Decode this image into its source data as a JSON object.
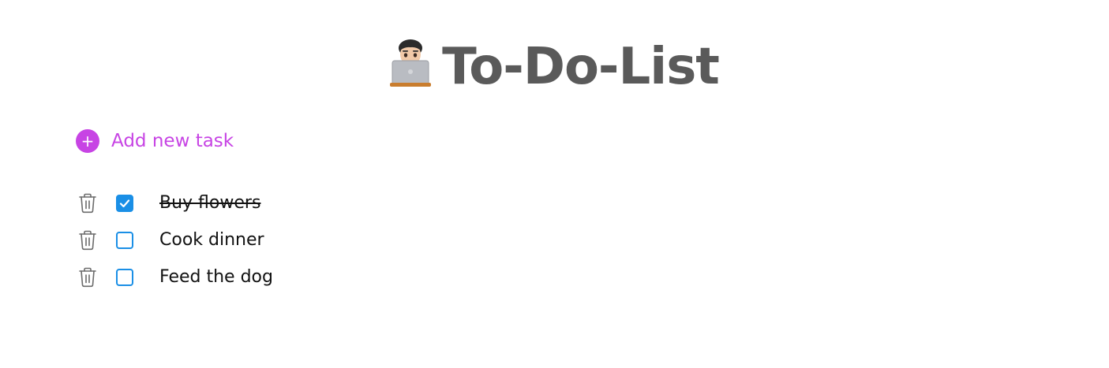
{
  "header": {
    "title": "To-Do-List",
    "avatar_icon": "memoji-laptop-icon"
  },
  "add_task": {
    "icon": "plus-circle-icon",
    "label": "Add new task",
    "accent_color": "#c744e4"
  },
  "tasks": [
    {
      "text": "Buy flowers",
      "completed": true
    },
    {
      "text": "Cook dinner",
      "completed": false
    },
    {
      "text": "Feed the dog",
      "completed": false
    }
  ],
  "colors": {
    "title": "#5a5a5a",
    "checkbox": "#1a8fe6",
    "trash_icon": "#6b6b6b"
  }
}
